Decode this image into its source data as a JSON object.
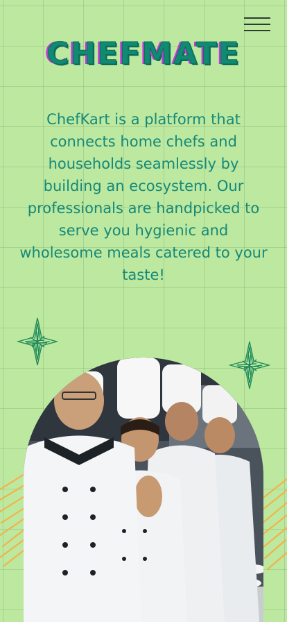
{
  "header": {
    "brand": "CHEFMATE",
    "menu_icon": "hamburger-menu-icon"
  },
  "intro": {
    "text": "ChefKart is a platform that\nconnects home chefs and\nhouseholds seamlessly by\nbuilding an ecosystem. Our\nprofessionals are handpicked to\nserve you hygienic and\nwholesome meals catered to your\ntaste!"
  },
  "hero": {
    "image": "chefs-team-photo",
    "decorations": [
      "green-sparkle-icon",
      "green-sparkle-icon",
      "orange-swirl-icon",
      "orange-swirl-icon"
    ]
  },
  "colors": {
    "background": "#bde89f",
    "accent_teal": "#118a72",
    "text_teal": "#14897a",
    "brand_shadow_magenta": "#c23bd4",
    "sparkle_green": "#1e8a5a",
    "swirl_orange": "#f3b24a"
  }
}
